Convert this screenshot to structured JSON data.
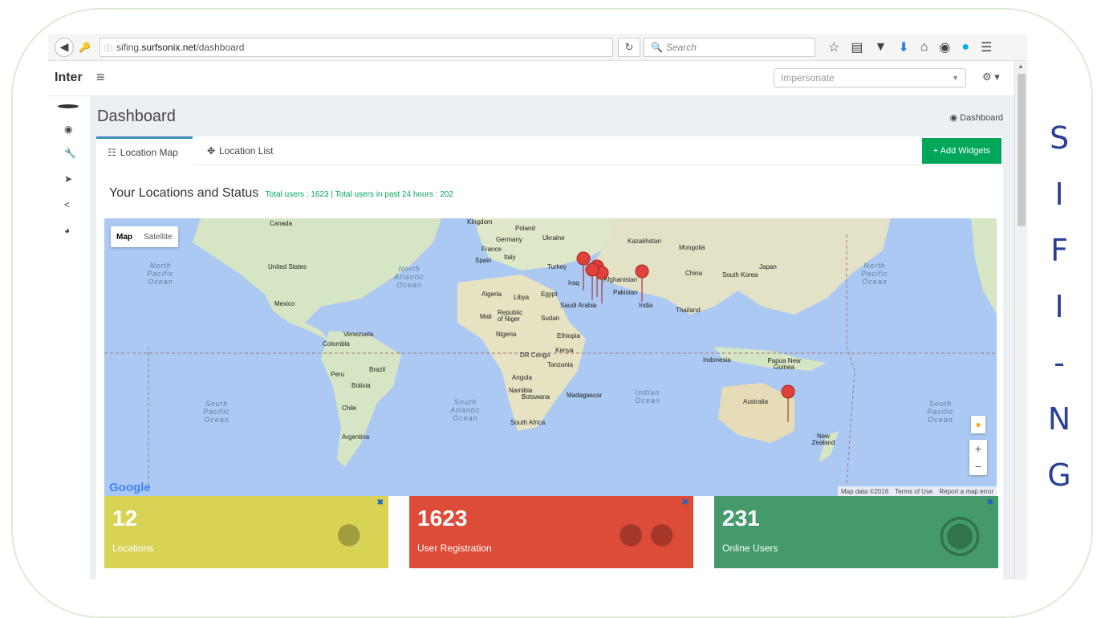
{
  "browser": {
    "url_prefix": "sifing.",
    "url_host": "surfsonix.net",
    "url_path": "/dashboard",
    "search_placeholder": "Search"
  },
  "header": {
    "brand": "Inter",
    "impersonate_placeholder": "Impersonate"
  },
  "page": {
    "title": "Dashboard",
    "breadcrumb": "Dashboard"
  },
  "tabs": [
    {
      "label": "Location Map",
      "active": true
    },
    {
      "label": "Location List",
      "active": false
    }
  ],
  "add_widgets_label": "+ Add Widgets",
  "section": {
    "title": "Your Locations and Status",
    "stats": "Total users : 1623 | Total users in past 24 hours : 202"
  },
  "map": {
    "toggle_map": "Map",
    "toggle_satellite": "Satellite",
    "google": "Google",
    "footer": [
      "Map data ©2016",
      "Terms of Use",
      "Report a map error"
    ],
    "countries": [
      "Canada",
      "United States",
      "Mexico",
      "Venezuela",
      "Colombia",
      "Peru",
      "Brazil",
      "Bolivia",
      "Chile",
      "Argentina",
      "Kingdom",
      "Poland",
      "Germany",
      "Ukraine",
      "France",
      "Italy",
      "Spain",
      "Turkey",
      "Iraq",
      "Afghanistan",
      "Pakistan",
      "Algeria",
      "Libya",
      "Egypt",
      "Saudi Arabia",
      "Mali",
      "Republic of Niger",
      "Sudan",
      "Nigeria",
      "Ethiopia",
      "DR Congo",
      "Kenya",
      "Tanzania",
      "Angola",
      "Namibia",
      "Botswana",
      "South Africa",
      "Madagascar",
      "Kazakhstan",
      "Mongolia",
      "China",
      "Japan",
      "South Korea",
      "India",
      "Thailand",
      "Indonesia",
      "Papua New Guinea",
      "Australia",
      "New Zealand"
    ],
    "oceans": [
      "North Pacific Ocean",
      "North Atlantic Ocean",
      "South Pacific Ocean",
      "South Atlantic Ocean",
      "Indian Ocean",
      "North Pacific Ocean",
      "South Pacific Ocean"
    ],
    "marker_count": 6
  },
  "widgets": [
    {
      "value": "12",
      "label": "Locations",
      "color": "#d8d355"
    },
    {
      "value": "1623",
      "label": "User Registration",
      "color": "#dd4b39"
    },
    {
      "value": "231",
      "label": "Online Users",
      "color": "#449a6b"
    }
  ],
  "side_letters": [
    "S",
    "I",
    "F",
    "I",
    "-",
    "N",
    "G"
  ]
}
